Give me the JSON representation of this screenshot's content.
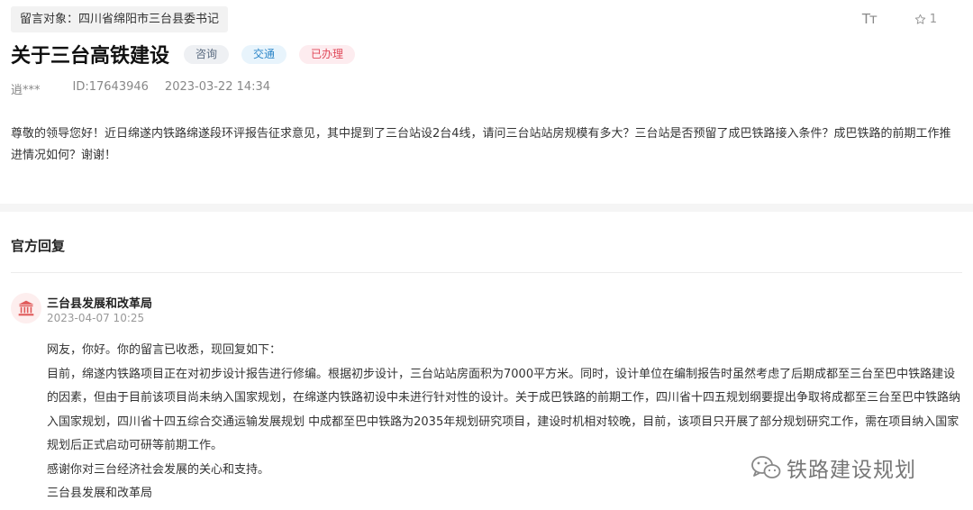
{
  "header": {
    "target_label": "留言对象：四川省绵阳市三台县委书记",
    "font_size_icon": "Tт",
    "favorite_count": "1"
  },
  "post": {
    "title": "关于三台高铁建设",
    "tags": [
      "咨询",
      "交通",
      "已办理"
    ],
    "author": "逍***",
    "id": "ID:17643946",
    "datetime": "2023-03-22 14:34",
    "content": "尊敬的领导您好！近日绵遂内铁路绵遂段环评报告征求意见，其中提到了三台站设2台4线，请问三台站站房规模有多大？三台站是否预留了成巴铁路接入条件？成巴铁路的前期工作推进情况如何？谢谢！"
  },
  "reply": {
    "heading": "官方回复",
    "org_name": "三台县发展和改革局",
    "date": "2023-04-07 10:25",
    "paragraphs": [
      "网友，你好。你的留言已收悉，现回复如下：",
      "目前，绵遂内铁路项目正在对初步设计报告进行修编。根据初步设计，三台站站房面积为7000平方米。同时，设计单位在编制报告时虽然考虑了后期成都至三台至巴中铁路建设的因素，但由于目前该项目尚未纳入国家规划，在绵遂内铁路初设中未进行针对性的设计。关于成巴铁路的前期工作，四川省十四五规划纲要提出争取将成都至三台至巴中铁路纳入国家规划，四川省十四五综合交通运输发展规划 中成都至巴中铁路为2035年规划研究项目，建设时机相对较晚，目前，该项目只开展了部分规划研究工作，需在项目纳入国家规划后正式启动可研等前期工作。",
      "感谢你对三台经济社会发展的关心和支持。",
      "三台县发展和改革局"
    ]
  },
  "watermark": {
    "text": "铁路建设规划",
    "icon": "wechat-icon"
  },
  "colors": {
    "tag_gray_bg": "#eef0f3",
    "tag_blue_bg": "#e8f4fc",
    "tag_red_bg": "#fdecef",
    "org_icon": "#e05a5a"
  }
}
